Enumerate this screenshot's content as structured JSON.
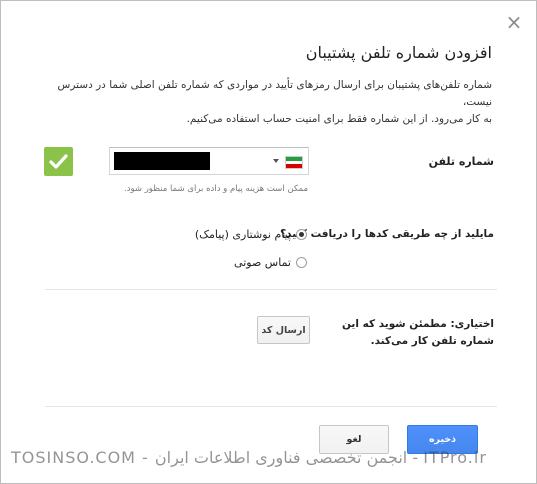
{
  "dialog": {
    "close_glyph": "×",
    "title": "افزودن شماره تلفن پشتیبان",
    "description": [
      "شماره تلفن‌های پشتیبان برای ارسال رمزهای تأیید در مواردی که شماره تلفن اصلی شما در دسترس نیست،",
      "به کار می‌رود. از این شماره فقط برای امنیت حساب استفاده می‌کنیم."
    ]
  },
  "phone": {
    "label": "شماره تلفن",
    "value": "",
    "country_icon": "iran-flag-icon",
    "status_icon": "checkmark-icon",
    "hint": "ممکن است هزینه پیام و داده برای شما منظور شود."
  },
  "method": {
    "question": "مایلید از چه طریقی کدها را دریافت کنید؟",
    "options": [
      {
        "label": "پیام نوشتاری (پیامک)",
        "selected": true
      },
      {
        "label": "تماس صوتی",
        "selected": false
      }
    ]
  },
  "optional": {
    "text_line1": "اختیاری: مطمئن شوید که این",
    "text_line2": "شماره تلفن کار می‌کند.",
    "send_button": "ارسال کد"
  },
  "footer": {
    "cancel_button": "لغو",
    "save_button": "ذخیره"
  },
  "watermark": "TOSINSO.COM - انجمن تخصصی فناوری اطلاعات ایران - ITPro.ir",
  "colors": {
    "accent": "#4d90fe",
    "check_green": "#8bc34a"
  }
}
